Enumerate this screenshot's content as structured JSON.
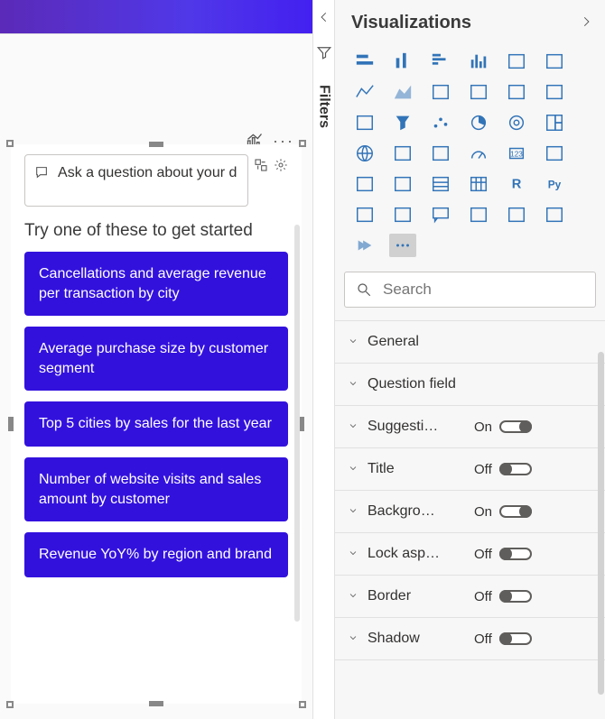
{
  "canvas": {
    "visual_menu_icons": [
      "bar-with-trend-icon",
      "more-icon"
    ]
  },
  "qna": {
    "placeholder": "Ask a question about your data",
    "prompt": "Try one of these to get started",
    "suggestions": [
      "Cancellations and average revenue per transaction by city",
      "Average purchase size by customer segment",
      "Top 5 cities by sales for the last year",
      "Number of website visits and sales amount by customer",
      "Revenue YoY% by region and brand"
    ],
    "suggestion_color": "#3311dd",
    "icons": [
      "convert-icon",
      "gear-icon"
    ]
  },
  "filters_rail": {
    "label": "Filters"
  },
  "viz_pane": {
    "title": "Visualizations",
    "search_placeholder": "Search",
    "selected_visual_index": 37,
    "gallery": [
      "stacked-bar",
      "stacked-column",
      "clustered-bar",
      "clustered-column",
      "hundred-bar",
      "hundred-column",
      "line",
      "area",
      "stacked-area",
      "line-stacked-column",
      "line-clustered-column",
      "ribbon",
      "waterfall",
      "funnel",
      "scatter",
      "pie",
      "donut",
      "treemap",
      "map",
      "filled-map",
      "shape-map",
      "gauge",
      "card",
      "multi-row-card",
      "kpi",
      "slicer",
      "table",
      "matrix",
      "r-visual",
      "py-visual",
      "key-influencers",
      "decomposition-tree",
      "qna",
      "narrative",
      "paginated",
      "power-apps",
      "power-automate",
      "more-visuals"
    ],
    "format_sections": [
      {
        "label": "General",
        "toggle": null
      },
      {
        "label": "Question field",
        "toggle": null
      },
      {
        "label": "Suggesti…",
        "toggle": "On"
      },
      {
        "label": "Title",
        "toggle": "Off"
      },
      {
        "label": "Backgro…",
        "toggle": "On"
      },
      {
        "label": "Lock asp…",
        "toggle": "Off"
      },
      {
        "label": "Border",
        "toggle": "Off"
      },
      {
        "label": "Shadow",
        "toggle": "Off"
      }
    ]
  }
}
